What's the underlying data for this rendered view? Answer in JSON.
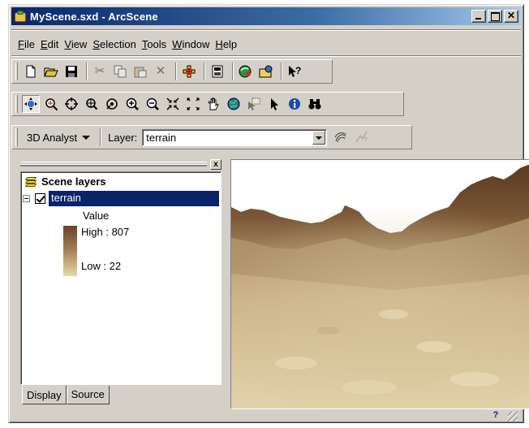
{
  "window": {
    "title": "MyScene.sxd - ArcScene"
  },
  "menu": {
    "items": [
      {
        "label": "File",
        "accel": "F",
        "rest": "ile"
      },
      {
        "label": "Edit",
        "accel": "E",
        "rest": "dit"
      },
      {
        "label": "View",
        "accel": "V",
        "rest": "iew"
      },
      {
        "label": "Selection",
        "accel": "S",
        "rest": "election"
      },
      {
        "label": "Tools",
        "accel": "T",
        "rest": "ools"
      },
      {
        "label": "Window",
        "accel": "W",
        "rest": "indow"
      },
      {
        "label": "Help",
        "accel": "H",
        "rest": "elp"
      }
    ]
  },
  "toolbars": {
    "standard": [
      "new-icon",
      "open-icon",
      "save-icon",
      "cut-icon",
      "copy-icon",
      "paste-icon",
      "delete-icon",
      "add-data-icon",
      "scene-properties-icon",
      "arctoolbox-icon",
      "arccatalog-icon",
      "whats-this-icon"
    ],
    "navigation": [
      "navigate-icon",
      "fly-icon",
      "target-center-icon",
      "zoom-to-target-icon",
      "set-observer-icon",
      "zoom-in-icon",
      "zoom-out-icon",
      "narrow-fov-icon",
      "expand-fov-icon",
      "pan-icon",
      "full-extent-icon",
      "select-features-icon",
      "select-elements-icon",
      "identify-icon",
      "find-icon"
    ]
  },
  "analyst": {
    "dropdown_label": "3D Analyst",
    "layer_label": "Layer:",
    "layer_value": "terrain"
  },
  "toc": {
    "root_label": "Scene layers",
    "layer_name": "terrain",
    "legend_title": "Value",
    "legend_high": "High : 807",
    "legend_low": "Low : 22",
    "tabs": [
      "Display",
      "Source"
    ],
    "close_label": "x"
  },
  "status": {
    "help_glyph": "?"
  }
}
